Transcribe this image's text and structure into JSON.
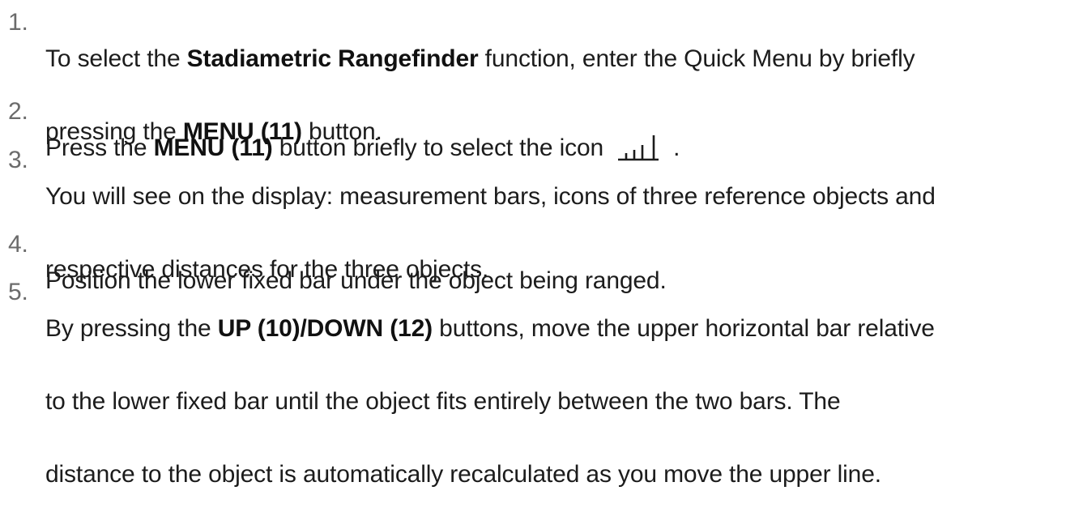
{
  "steps": [
    {
      "number": "1.",
      "line1": {
        "a": "To select the ",
        "b": "Stadiametric Rangefinder",
        "c": " function, enter the Quick Menu by briefly"
      },
      "line2": {
        "a": "pressing the ",
        "b": "MENU (11)",
        "c": " button."
      }
    },
    {
      "number": "2.",
      "line1": {
        "a": "Press the ",
        "b": "MENU (11)",
        "c": " button briefly to select the icon",
        "d": "."
      },
      "icon": "stadiametric-rangefinder-icon"
    },
    {
      "number": "3.",
      "line1": "You will see on the display: measurement bars, icons of three reference objects and",
      "line2": "respective distances for the three objects."
    },
    {
      "number": "4.",
      "line1": "Position the lower fixed bar under the object being ranged."
    },
    {
      "number": "5.",
      "line1": {
        "a": "By pressing the ",
        "b": "UP (10)/DOWN (12)",
        "c": " buttons, move the upper horizontal bar relative"
      },
      "line2": "to the lower fixed bar until the object fits entirely between the two bars. The",
      "line3": "distance to the object is automatically recalculated as you move the upper line."
    }
  ]
}
